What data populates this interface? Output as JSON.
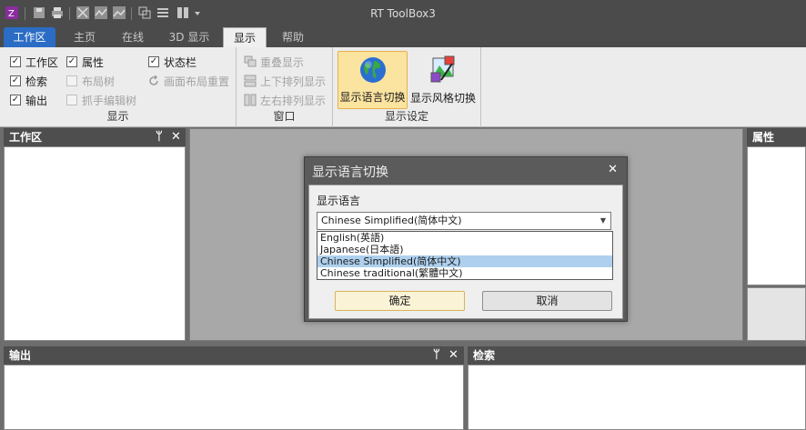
{
  "window": {
    "title": "RT ToolBox3"
  },
  "quick_access": [
    "app-icon",
    "save-icon",
    "print-icon",
    "graph-icon-1",
    "graph-icon-2",
    "graph-icon-3",
    "window-layout-icon",
    "list-icon",
    "columns-icon",
    "dropdown-arrow-icon"
  ],
  "tabs": [
    "工作区",
    "主页",
    "在线",
    "3D 显示",
    "显示",
    "帮助"
  ],
  "ribbon": {
    "group_display": {
      "label": "显示",
      "checks": [
        {
          "label": "工作区",
          "checked": true,
          "enabled": true
        },
        {
          "label": "属性",
          "checked": true,
          "enabled": true
        },
        {
          "label": "状态栏",
          "checked": true,
          "enabled": true
        },
        {
          "label": "检索",
          "checked": true,
          "enabled": true
        },
        {
          "label": "布局树",
          "checked": false,
          "enabled": false
        },
        {
          "label": "画面布局重置",
          "checked": false,
          "enabled": false,
          "icon": "refresh-icon"
        },
        {
          "label": "输出",
          "checked": true,
          "enabled": true
        },
        {
          "label": "抓手编辑树",
          "checked": false,
          "enabled": false
        }
      ]
    },
    "group_window": {
      "label": "窗口",
      "items": [
        "重叠显示",
        "上下排列显示",
        "左右排列显示"
      ]
    },
    "group_settings": {
      "label": "显示设定",
      "buttons": [
        "显示语言切换",
        "显示风格切换"
      ]
    }
  },
  "panels": {
    "workspace": {
      "title": "工作区",
      "pin": "ᛘ",
      "close": "✕"
    },
    "properties": {
      "title": "属性"
    },
    "output": {
      "title": "输出",
      "pin": "ᛘ",
      "close": "✕"
    },
    "search": {
      "title": "检索"
    }
  },
  "dialog": {
    "title": "显示语言切换",
    "close": "✕",
    "label": "显示语言",
    "selected": "Chinese Simplified(简体中文)",
    "options": [
      "English(英語)",
      "Japanese(日本語)",
      "Chinese Simplified(简体中文)",
      "Chinese traditional(繁體中文)"
    ],
    "selected_index": 2,
    "ok": "确定",
    "cancel": "取消"
  },
  "colors": {
    "titlebar": "#4b4b4b",
    "file_tab": "#2b6cc4",
    "highlight": "#fbe3a0",
    "selection": "#aed0ee"
  }
}
